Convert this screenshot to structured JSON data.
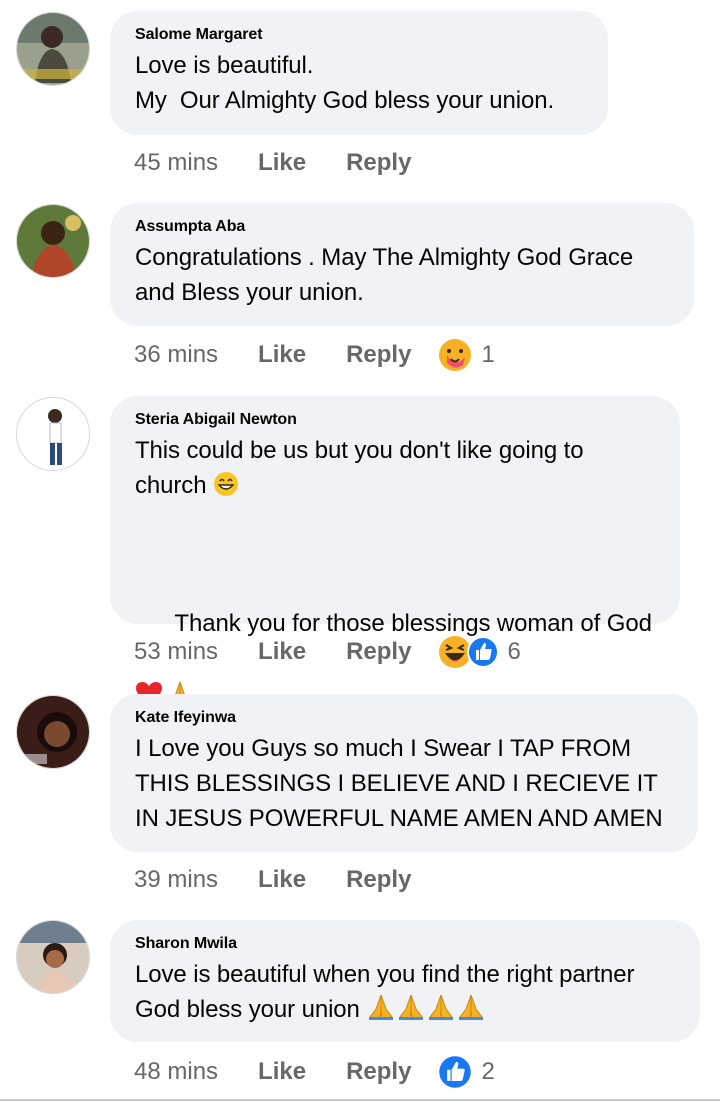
{
  "comments": [
    {
      "author": "Salome Margaret",
      "text": "Love is beautiful.\nMy  Our Almighty God bless your union.",
      "time": "45 mins",
      "like": "Like",
      "reply": "Reply",
      "reaction_count": "",
      "avatar_color": "#8a8f79"
    },
    {
      "author": "Assumpta Aba",
      "text": "Congratulations . May The Almighty God Grace\nand Bless your union.",
      "time": "36 mins",
      "like": "Like",
      "reply": "Reply",
      "reaction_count": "1",
      "avatar_color": "#6f5a2e"
    },
    {
      "author": "Steria Abigail Newton",
      "text": "This could be us but you don't like going to\nchurch",
      "text2": "Thank you for those blessings woman of God",
      "time": "53 mins",
      "like": "Like",
      "reply": "Reply",
      "reaction_count": "6",
      "avatar_color": "#f4f4f4"
    },
    {
      "author": "Kate Ifeyinwa",
      "text": "I Love you Guys so much I Swear I TAP FROM\nTHIS BLESSINGS I BELIEVE AND I RECIEVE IT\nIN JESUS POWERFUL NAME AMEN AND AMEN",
      "time": "39 mins",
      "like": "Like",
      "reply": "Reply",
      "reaction_count": "",
      "avatar_color": "#3a2018"
    },
    {
      "author": "Sharon Mwila",
      "text": "Love is beautiful when you find the right partner\nGod bless your union",
      "time": "48 mins",
      "like": "Like",
      "reply": "Reply",
      "reaction_count": "2",
      "avatar_color": "#c9b7a6"
    }
  ],
  "colors": {
    "bubble": "#f0f2f5",
    "meta_text": "#65676b",
    "like_blue": "#1877f2"
  }
}
